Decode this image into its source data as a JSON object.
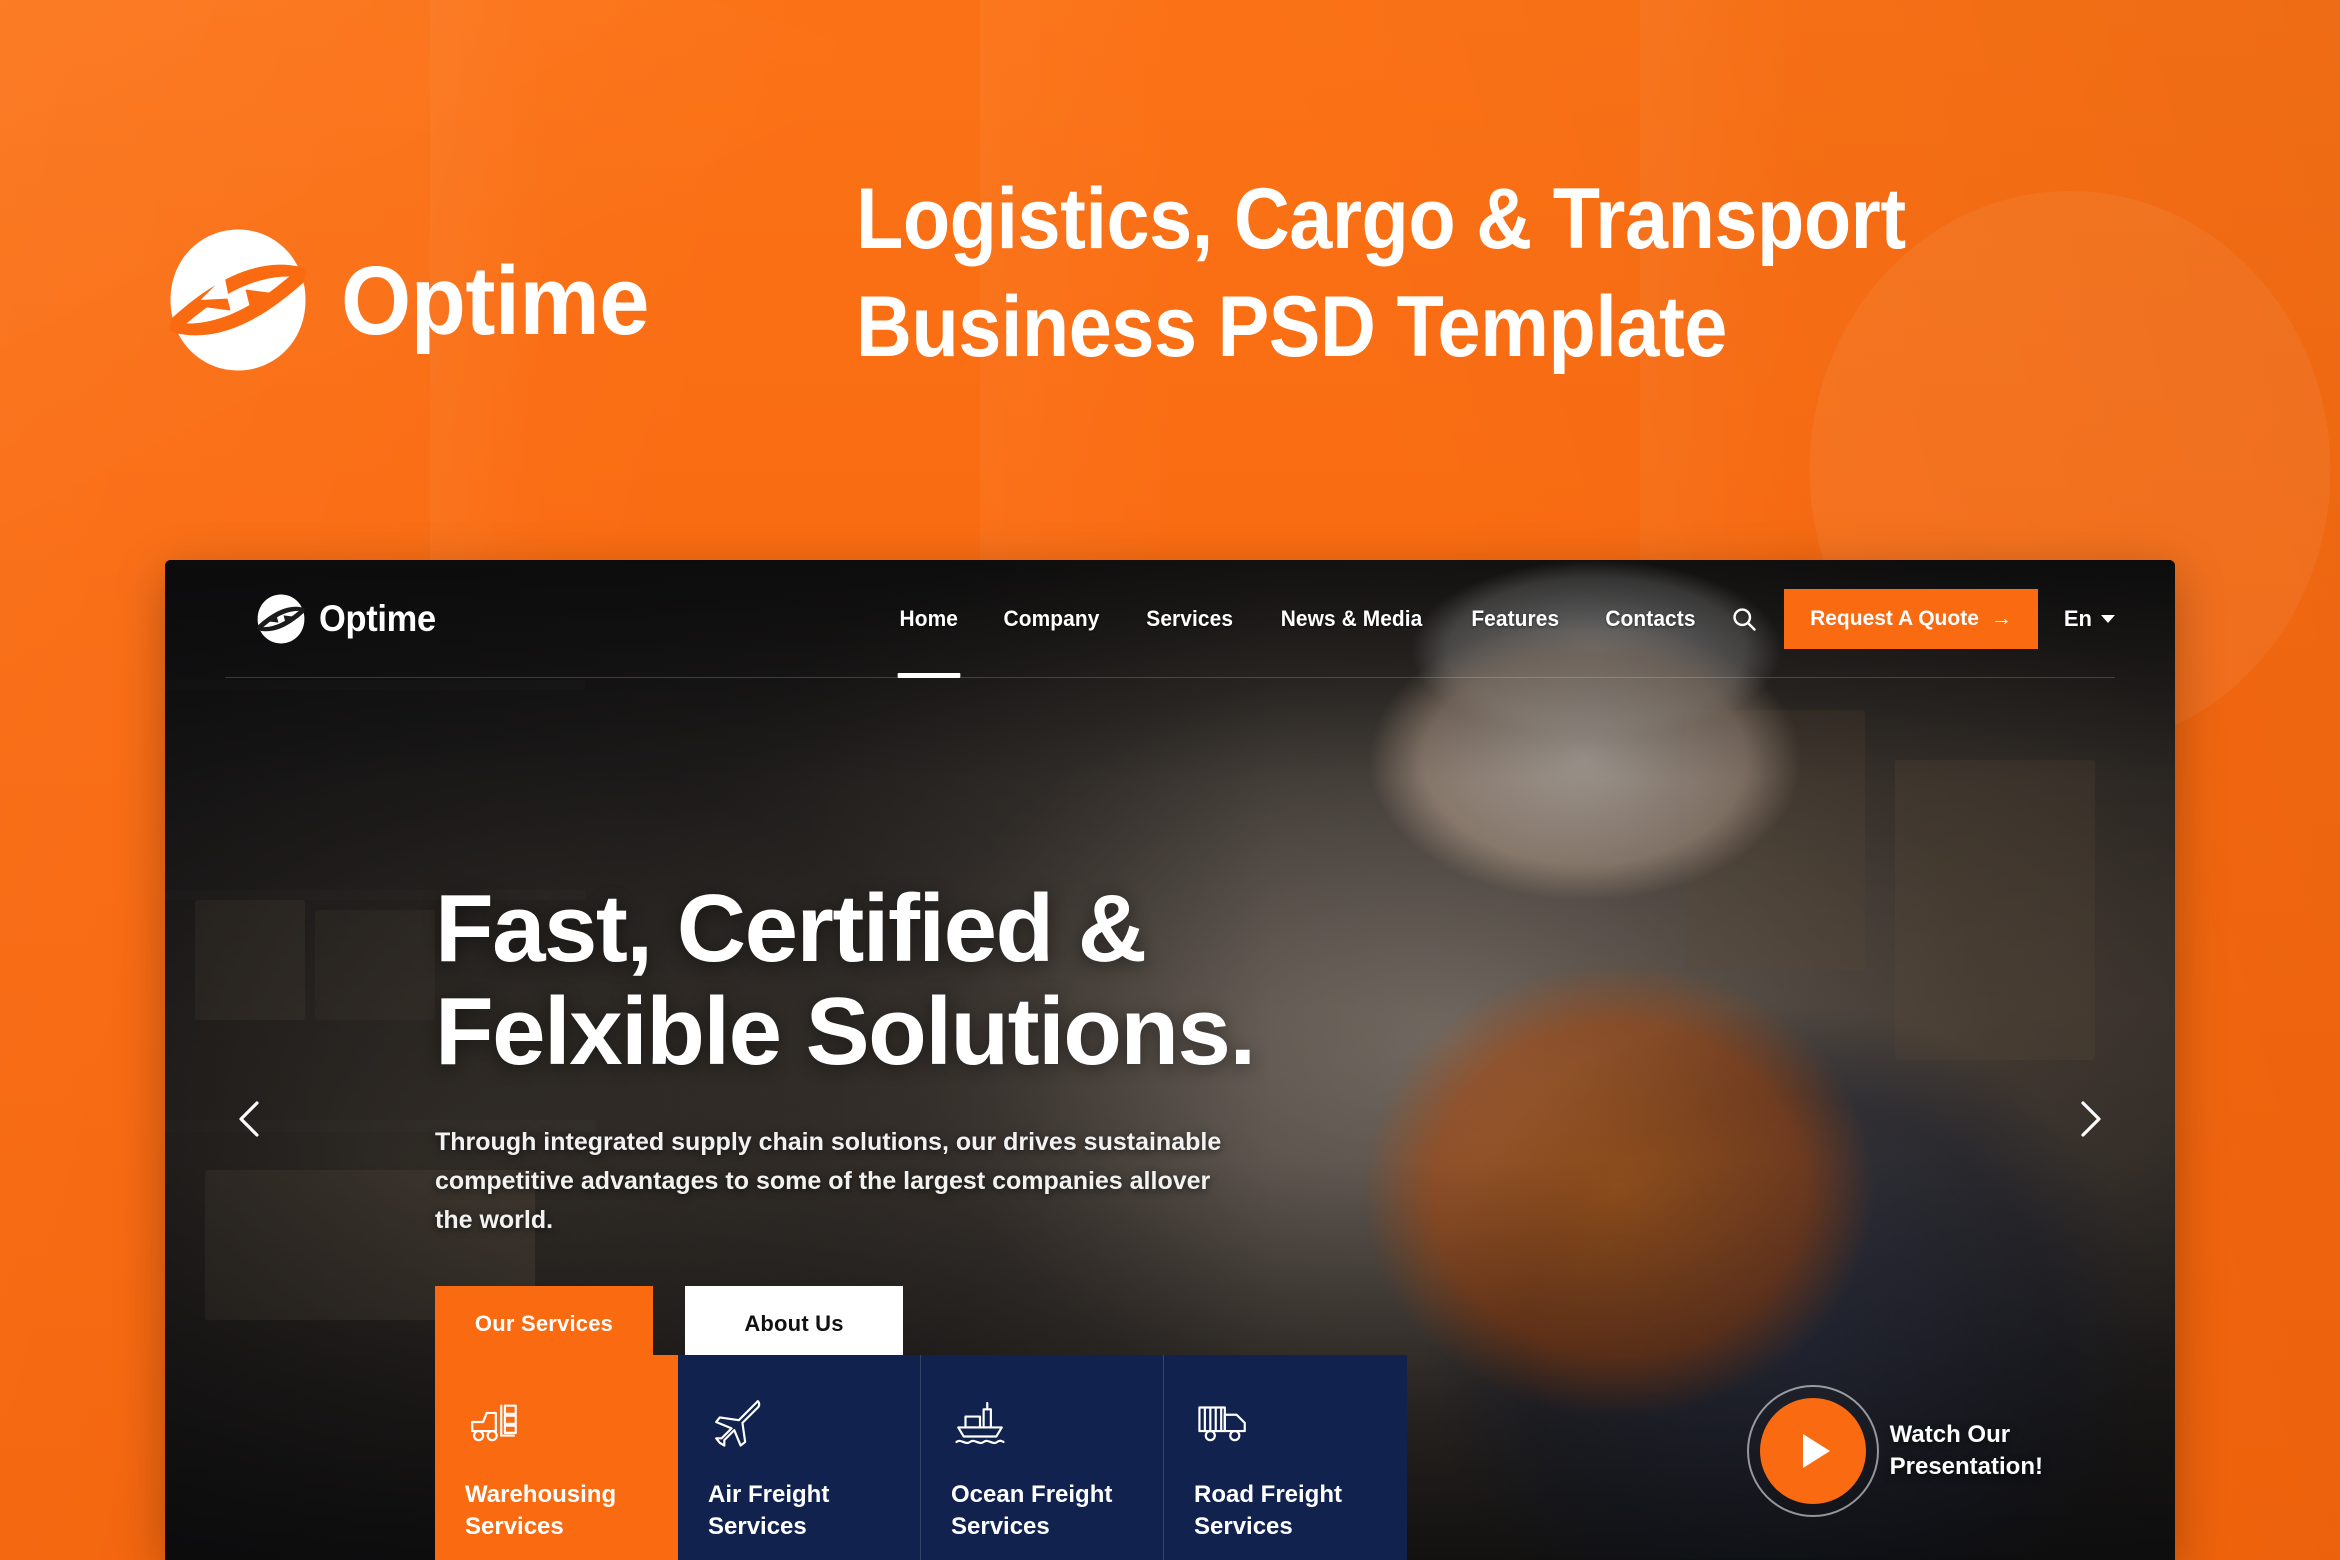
{
  "promo": {
    "brand_name": "Optime",
    "logo_icon": "optime-swirl-logo",
    "headline_line1": "Logistics, Cargo & Transport",
    "headline_line2": "Business PSD Template",
    "background_color": "#F96A11"
  },
  "site": {
    "brand_name": "Optime",
    "logo_icon": "optime-swirl-logo",
    "nav": [
      {
        "label": "Home",
        "active": true
      },
      {
        "label": "Company",
        "active": false
      },
      {
        "label": "Services",
        "active": false
      },
      {
        "label": "News & Media",
        "active": false
      },
      {
        "label": "Features",
        "active": false
      },
      {
        "label": "Contacts",
        "active": false
      }
    ],
    "search_icon": "search-icon",
    "quote_button": "Request A Quote",
    "quote_button_arrow": "→",
    "language": "En",
    "accent_color": "#F96A11"
  },
  "hero": {
    "title_line1": "Fast, Certified &",
    "title_line2": "Felxible Solutions.",
    "subtitle_line1": "Through integrated supply chain solutions, our drives sustainable competitive",
    "subtitle_line2": "advantages to some of the largest companies allover the world.",
    "primary_button": "Our Services",
    "secondary_button": "About Us",
    "prev_arrow_icon": "chevron-left-icon",
    "next_arrow_icon": "chevron-right-icon"
  },
  "services": [
    {
      "icon": "forklift-icon",
      "line1": "Warehousing",
      "line2": "Services",
      "featured": true
    },
    {
      "icon": "airplane-icon",
      "line1": "Air Freight",
      "line2": "Services",
      "featured": false
    },
    {
      "icon": "cargo-ship-icon",
      "line1": "Ocean Freight",
      "line2": "Services",
      "featured": false
    },
    {
      "icon": "truck-icon",
      "line1": "Road Freight",
      "line2": "Services",
      "featured": false
    }
  ],
  "watch": {
    "play_icon": "play-icon",
    "line1": "Watch Our",
    "line2": "Presentation!"
  },
  "colors": {
    "orange": "#F96A11",
    "navy": "#12224F",
    "white": "#FFFFFF"
  }
}
